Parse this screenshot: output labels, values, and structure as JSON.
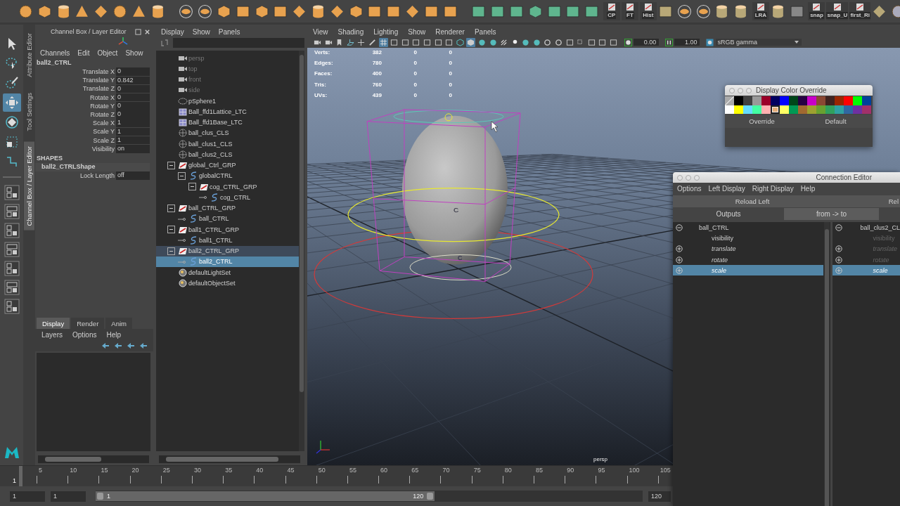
{
  "shelf": {
    "labels": [
      "CP",
      "FT",
      "Hist",
      "LRA",
      "snap",
      "snap_U",
      "first_Ri"
    ]
  },
  "toolbox": [
    {
      "kind": "select",
      "selected": false
    },
    {
      "kind": "lasso",
      "selected": false
    },
    {
      "kind": "paint",
      "selected": false
    },
    {
      "kind": "move",
      "selected": true
    },
    {
      "kind": "rotate",
      "selected": false
    },
    {
      "kind": "scale",
      "selected": false
    },
    {
      "kind": "last",
      "selected": false
    }
  ],
  "side_tabs": [
    {
      "label": "Attribute Editor",
      "selected": false
    },
    {
      "label": "Tool Settings",
      "selected": false
    },
    {
      "label": "Channel Box / Layer Editor",
      "selected": true
    }
  ],
  "channel_box": {
    "title": "Channel Box / Layer Editor",
    "menu": [
      "Channels",
      "Edit",
      "Object",
      "Show"
    ],
    "node": "ball2_CTRL",
    "attributes": [
      {
        "name": "Translate X",
        "value": "0"
      },
      {
        "name": "Translate Y",
        "value": "0.842"
      },
      {
        "name": "Translate Z",
        "value": "0"
      },
      {
        "name": "Rotate X",
        "value": "0"
      },
      {
        "name": "Rotate Y",
        "value": "0"
      },
      {
        "name": "Rotate Z",
        "value": "0"
      },
      {
        "name": "Scale X",
        "value": "1"
      },
      {
        "name": "Scale Y",
        "value": "1"
      },
      {
        "name": "Scale Z",
        "value": "1"
      },
      {
        "name": "Visibility",
        "value": "on"
      }
    ],
    "shapes_heading": "SHAPES",
    "shape_node": "ball2_CTRLShape",
    "shape_attributes": [
      {
        "name": "Lock Length",
        "value": "off"
      }
    ]
  },
  "layer_editor": {
    "tabs": [
      {
        "label": "Display",
        "selected": true
      },
      {
        "label": "Render",
        "selected": false
      },
      {
        "label": "Anim",
        "selected": false
      }
    ],
    "menu": [
      "Layers",
      "Options",
      "Help"
    ]
  },
  "outliner": {
    "menu": [
      "Display",
      "Show",
      "Panels"
    ],
    "items": [
      {
        "label": "persp",
        "kind": "camera",
        "hidden": true,
        "selected": false,
        "highlighted": false
      },
      {
        "label": "top",
        "kind": "camera",
        "hidden": true,
        "selected": false,
        "highlighted": false
      },
      {
        "label": "front",
        "kind": "camera",
        "hidden": true,
        "selected": false,
        "highlighted": false
      },
      {
        "label": "side",
        "kind": "camera",
        "hidden": true,
        "selected": false,
        "highlighted": false
      },
      {
        "label": "pSphere1",
        "kind": "mesh",
        "hidden": false,
        "selected": false,
        "highlighted": false
      },
      {
        "label": "Ball_ffd1Lattice_LTC",
        "kind": "lattice",
        "hidden": false,
        "selected": false,
        "highlighted": false
      },
      {
        "label": "Ball_ffd1Base_LTC",
        "kind": "lattice",
        "hidden": false,
        "selected": false,
        "highlighted": false
      },
      {
        "label": "ball_clus_CLS",
        "kind": "cluster",
        "hidden": false,
        "selected": false,
        "highlighted": false
      },
      {
        "label": "ball_clus1_CLS",
        "kind": "cluster",
        "hidden": false,
        "selected": false,
        "highlighted": false
      },
      {
        "label": "ball_clus2_CLS",
        "kind": "cluster",
        "hidden": false,
        "selected": false,
        "highlighted": false
      },
      {
        "label": "global_Ctrl_GRP",
        "kind": "group",
        "hidden": false,
        "selected": false,
        "highlighted": false,
        "expanded": true,
        "children": [
          {
            "label": "globalCTRL",
            "kind": "curve",
            "hidden": false,
            "selected": false,
            "highlighted": false,
            "expanded": true,
            "children": [
              {
                "label": "cog_CTRL_GRP",
                "kind": "group",
                "hidden": false,
                "selected": false,
                "highlighted": false,
                "expanded": true,
                "children": [
                  {
                    "label": "cog_CTRL",
                    "kind": "curve",
                    "hidden": false,
                    "selected": false,
                    "highlighted": false
                  }
                ]
              }
            ]
          }
        ]
      },
      {
        "label": "ball_CTRL_GRP",
        "kind": "group",
        "hidden": false,
        "selected": false,
        "highlighted": false,
        "expanded": true,
        "children": [
          {
            "label": "ball_CTRL",
            "kind": "curve",
            "hidden": false,
            "selected": false,
            "highlighted": false
          }
        ]
      },
      {
        "label": "ball1_CTRL_GRP",
        "kind": "group",
        "hidden": false,
        "selected": false,
        "highlighted": false,
        "expanded": true,
        "children": [
          {
            "label": "ball1_CTRL",
            "kind": "curve",
            "hidden": false,
            "selected": false,
            "highlighted": false
          }
        ]
      },
      {
        "label": "ball2_CTRL_GRP",
        "kind": "group",
        "hidden": false,
        "selected": false,
        "highlighted": true,
        "expanded": true,
        "children": [
          {
            "label": "ball2_CTRL",
            "kind": "curve",
            "hidden": false,
            "selected": true,
            "highlighted": false
          }
        ]
      },
      {
        "label": "defaultLightSet",
        "kind": "set",
        "hidden": false,
        "selected": false,
        "highlighted": false
      },
      {
        "label": "defaultObjectSet",
        "kind": "set",
        "hidden": false,
        "selected": false,
        "highlighted": false
      }
    ]
  },
  "viewport": {
    "menu": [
      "View",
      "Shading",
      "Lighting",
      "Show",
      "Renderer",
      "Panels"
    ],
    "toolbar": [
      {
        "kind": "camera",
        "selected": false
      },
      {
        "kind": "camera",
        "selected": false
      },
      {
        "kind": "bookmark",
        "selected": false
      },
      {
        "kind": "plane",
        "selected": false
      },
      {
        "kind": "axes",
        "selected": false
      },
      {
        "kind": "brush",
        "selected": false
      },
      {
        "kind": "grid",
        "selected": true
      },
      {
        "kind": "frame",
        "selected": false
      },
      {
        "kind": "frame",
        "selected": false
      },
      {
        "kind": "frame",
        "selected": false
      },
      {
        "kind": "frame",
        "selected": false
      },
      {
        "kind": "frame",
        "selected": false
      },
      {
        "kind": "frame",
        "selected": false
      },
      {
        "kind": "wire",
        "selected": false
      },
      {
        "kind": "cube",
        "selected": true
      },
      {
        "kind": "sphere",
        "selected": false
      },
      {
        "kind": "sphere",
        "selected": false
      },
      {
        "kind": "checker",
        "selected": false
      },
      {
        "kind": "light",
        "selected": false
      },
      {
        "kind": "sphere",
        "selected": false
      },
      {
        "kind": "sphere",
        "selected": false
      },
      {
        "kind": "ring",
        "selected": false
      },
      {
        "kind": "ring",
        "selected": false
      },
      {
        "kind": "frame",
        "selected": false
      },
      {
        "kind": "select",
        "selected": false
      },
      {
        "kind": "frame",
        "selected": false
      },
      {
        "kind": "frame",
        "selected": false
      },
      {
        "kind": "frame",
        "selected": false
      }
    ],
    "exposure": "0.00",
    "gamma": "1.00",
    "color_space": "sRGB gamma",
    "stats": [
      {
        "label": "Verts:",
        "values": [
          "382",
          "0",
          "0"
        ]
      },
      {
        "label": "Edges:",
        "values": [
          "780",
          "0",
          "0"
        ]
      },
      {
        "label": "Faces:",
        "values": [
          "400",
          "0",
          "0"
        ]
      },
      {
        "label": "Tris:",
        "values": [
          "760",
          "0",
          "0"
        ]
      },
      {
        "label": "UVs:",
        "values": [
          "439",
          "0",
          "0"
        ]
      }
    ],
    "pivot_labels": [
      "C",
      "C"
    ],
    "camera": "persp"
  },
  "color_override": {
    "title": "Display Color Override",
    "swatches": [
      {
        "kind": "none",
        "selected": false
      },
      {
        "kind": "color",
        "color": "#000000",
        "selected": false
      },
      {
        "kind": "color",
        "color": "#404040",
        "selected": false
      },
      {
        "kind": "color",
        "color": "#999999",
        "selected": false
      },
      {
        "kind": "color",
        "color": "#9b0028",
        "selected": false
      },
      {
        "kind": "color",
        "color": "#000060",
        "selected": false
      },
      {
        "kind": "color",
        "color": "#0000ff",
        "selected": false
      },
      {
        "kind": "color",
        "color": "#004619",
        "selected": false
      },
      {
        "kind": "color",
        "color": "#260043",
        "selected": false
      },
      {
        "kind": "color",
        "color": "#c800c8",
        "selected": false
      },
      {
        "kind": "color",
        "color": "#8a4833",
        "selected": false
      },
      {
        "kind": "color",
        "color": "#3f231f",
        "selected": false
      },
      {
        "kind": "color",
        "color": "#992600",
        "selected": false
      },
      {
        "kind": "color",
        "color": "#ff0000",
        "selected": false
      },
      {
        "kind": "color",
        "color": "#00ff00",
        "selected": false
      },
      {
        "kind": "color",
        "color": "#004199",
        "selected": false
      },
      {
        "kind": "color",
        "color": "#ffffff",
        "selected": false
      },
      {
        "kind": "color",
        "color": "#ffff00",
        "selected": false
      },
      {
        "kind": "color",
        "color": "#64dcff",
        "selected": false
      },
      {
        "kind": "color",
        "color": "#43ffa3",
        "selected": false
      },
      {
        "kind": "color",
        "color": "#ffb0b0",
        "selected": false
      },
      {
        "kind": "color",
        "color": "#e4ac79",
        "selected": true
      },
      {
        "kind": "color",
        "color": "#ffff63",
        "selected": false
      },
      {
        "kind": "color",
        "color": "#009954",
        "selected": false
      },
      {
        "kind": "color",
        "color": "#a16930",
        "selected": false
      },
      {
        "kind": "color",
        "color": "#9ea130",
        "selected": false
      },
      {
        "kind": "color",
        "color": "#68a130",
        "selected": false
      },
      {
        "kind": "color",
        "color": "#30a15d",
        "selected": false
      },
      {
        "kind": "color",
        "color": "#30a1a1",
        "selected": false
      },
      {
        "kind": "color",
        "color": "#3067a1",
        "selected": false
      },
      {
        "kind": "color",
        "color": "#6f30a1",
        "selected": false
      },
      {
        "kind": "color",
        "color": "#a1306a",
        "selected": false
      }
    ],
    "buttons": [
      "Override",
      "Default"
    ]
  },
  "connection_editor": {
    "title": "Connection Editor",
    "menu": [
      "Options",
      "Left Display",
      "Right Display",
      "Help"
    ],
    "reload_buttons": [
      "Reload Left",
      "Rel"
    ],
    "outputs_label": "Outputs",
    "direction_button": "from -> to",
    "left": {
      "node": "ball_CTRL",
      "expanded": true,
      "attributes": [
        {
          "name": "visibility",
          "kind": "simple",
          "selected": false,
          "disabled": false
        },
        {
          "name": "translate",
          "kind": "compound",
          "selected": false,
          "disabled": false
        },
        {
          "name": "rotate",
          "kind": "compound",
          "selected": false,
          "disabled": false
        },
        {
          "name": "scale",
          "kind": "compound",
          "selected": true,
          "disabled": false
        }
      ]
    },
    "right": {
      "node": "ball_clus2_CL",
      "expanded": true,
      "attributes": [
        {
          "name": "visibility",
          "kind": "simple",
          "selected": false,
          "disabled": true
        },
        {
          "name": "translate",
          "kind": "compound",
          "selected": false,
          "disabled": true
        },
        {
          "name": "rotate",
          "kind": "compound",
          "selected": false,
          "disabled": true
        },
        {
          "name": "scale",
          "kind": "compound",
          "selected": true,
          "disabled": false
        }
      ]
    }
  },
  "timeline": {
    "current": "1",
    "ticks": [
      "5",
      "10",
      "15",
      "20",
      "25",
      "30",
      "35",
      "40",
      "45",
      "50",
      "55",
      "60",
      "65",
      "70",
      "75",
      "80",
      "85",
      "90",
      "95",
      "100",
      "105"
    ]
  },
  "range": {
    "level": 0.62,
    "start": "1",
    "range_start": "1",
    "slider_start": "1",
    "slider_end": "120",
    "range_end": "120"
  }
}
